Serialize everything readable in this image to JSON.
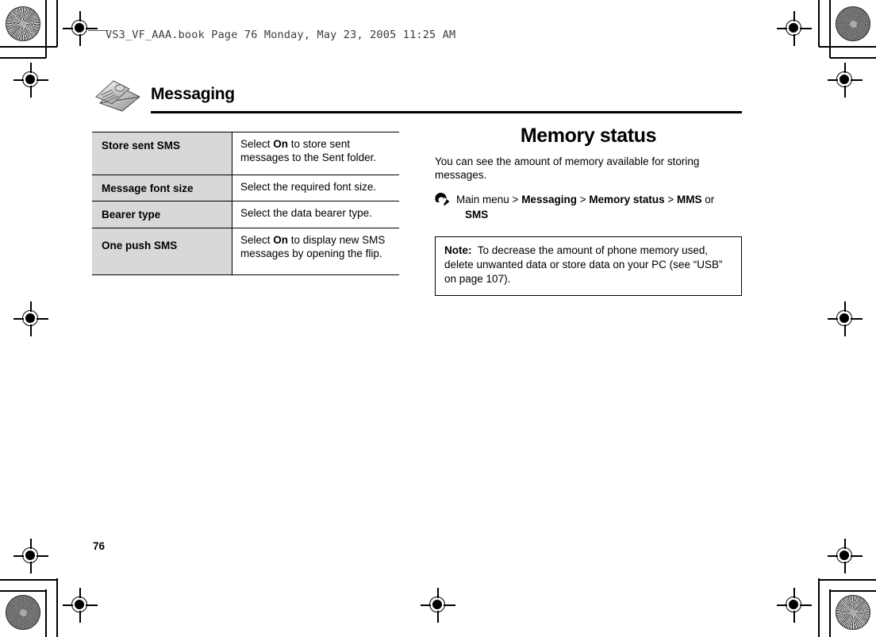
{
  "print_header": {
    "text": "VS3_VF_AAA.book  Page 76  Monday, May 23, 2005  11:25 AM"
  },
  "chapter": {
    "title": "Messaging",
    "icon": "envelope-letter-icon"
  },
  "settings_table": {
    "rows": [
      {
        "key": "Store sent SMS",
        "value_pre": "Select ",
        "value_bold": "On",
        "value_post": " to store sent messages to the Sent folder."
      },
      {
        "key": "Message font size",
        "value_pre": "Select the required font size.",
        "value_bold": "",
        "value_post": ""
      },
      {
        "key": "Bearer type",
        "value_pre": "Select the data bearer type.",
        "value_bold": "",
        "value_post": ""
      },
      {
        "key": "One push SMS",
        "value_pre": "Select ",
        "value_bold": "On",
        "value_post": " to display new SMS messages by opening the flip."
      }
    ]
  },
  "memory_status": {
    "title": "Memory status",
    "intro": "You can see the amount of memory available for storing messages.",
    "nav": {
      "icon": "arrow-right-circle-icon",
      "root": "Main menu",
      "sep1": " > ",
      "item1": "Messaging",
      "sep2": " > ",
      "item2": "Memory status",
      "sep3": " > ",
      "item3": "MMS",
      "conjunction": " or",
      "item4": "SMS"
    },
    "note": {
      "label": "Note:",
      "text": "To decrease the amount of phone memory used, delete unwanted data or store data on your PC (see “USB” on page 107)."
    }
  },
  "folio": {
    "page_number": "76"
  },
  "colors": {
    "table_key_bg": "#d8d8d8",
    "rule": "#000000",
    "text": "#000000"
  }
}
